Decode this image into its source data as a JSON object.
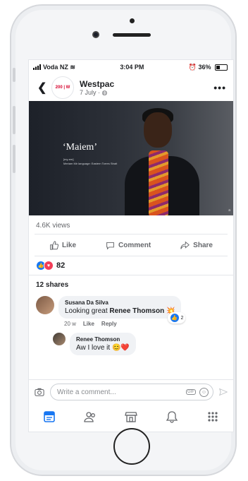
{
  "status_bar": {
    "carrier": "Voda NZ",
    "time": "3:04 PM",
    "battery": "36%"
  },
  "post": {
    "page_name": "Westpac",
    "date": "7 July · ",
    "logo_text": "200 | W",
    "photo": {
      "title": "‘Maiem’",
      "subtitle1": "[my-em]",
      "subtitle2": "Meriam Mir language: Eastern Torres Strait",
      "corner_mark": "a"
    },
    "views": "4.6K views",
    "actions": {
      "like": "Like",
      "comment": "Comment",
      "share": "Share"
    },
    "reaction_count": "82",
    "shares": "12 shares"
  },
  "comments": [
    {
      "author": "Susana Da Silva",
      "text": "Looking great ",
      "mention": "Renee Thomson",
      "emoji": "💥",
      "time": "20 w",
      "like_label": "Like",
      "reply_label": "Reply",
      "reaction_count": "2"
    },
    {
      "author": "Renee Thomson",
      "text": "Aw I love it ",
      "emoji": "😊❤️"
    }
  ],
  "composer": {
    "placeholder": "Write a comment...",
    "gif_label": "GIF"
  },
  "colors": {
    "accent": "#1877f2",
    "love": "#f33e58",
    "brand_red": "#d5002b"
  },
  "tabs": [
    "news-feed-icon",
    "groups-icon",
    "marketplace-icon",
    "notifications-icon",
    "menu-icon"
  ]
}
